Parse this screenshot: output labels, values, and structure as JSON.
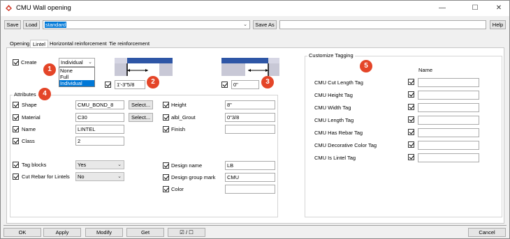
{
  "window": {
    "title": "CMU Wall opening",
    "minimize_glyph": "—",
    "maximize_glyph": "☐",
    "close_glyph": "✕"
  },
  "toolbar": {
    "save_label": "Save",
    "load_label": "Load",
    "preset_value": "standard",
    "save_as_label": "Save As",
    "save_as_value": "",
    "help_label": "Help"
  },
  "tabs": [
    {
      "label": "Opening"
    },
    {
      "label": "Lintel"
    },
    {
      "label": "Horizontal reinforcement"
    },
    {
      "label": "Tie reinforcement"
    }
  ],
  "lintel": {
    "create_label": "Create",
    "create_mode": "Individual",
    "create_options": [
      "None",
      "Full",
      "Individual"
    ],
    "left_offset": "1'-3\"5/8",
    "right_offset": "0\""
  },
  "attributes": {
    "title": "Attributes",
    "shape_label": "Shape",
    "shape_value": "CMU_BOND_8",
    "material_label": "Material",
    "material_value": "C30",
    "select_label": "Select...",
    "name_label": "Name",
    "name_value": "LINTEL",
    "class_label": "Class",
    "class_value": "2",
    "height_label": "Height",
    "height_value": "8\"",
    "grout_label": "albl_Grout",
    "grout_value": "0\"3/8",
    "finish_label": "Finish",
    "finish_value": "",
    "tag_blocks_label": "Tag blocks",
    "tag_blocks_value": "Yes",
    "cut_rebar_label": "Cut Rebar for Lintels",
    "cut_rebar_value": "No",
    "design_name_label": "Design name",
    "design_name_value": "LB",
    "design_group_label": "Design group mark",
    "design_group_value": "CMU",
    "color_label": "Color",
    "color_value": ""
  },
  "tagging": {
    "title": "Customize Tagging",
    "name_header": "Name",
    "tags": [
      {
        "label": "CMU Cut Length Tag",
        "value": ""
      },
      {
        "label": "CMU Height Tag",
        "value": ""
      },
      {
        "label": "CMU Width Tag",
        "value": ""
      },
      {
        "label": "CMU Length Tag",
        "value": ""
      },
      {
        "label": "CMU Has Rebar Tag",
        "value": ""
      },
      {
        "label": "CMU Decorative Color Tag",
        "value": ""
      },
      {
        "label": "CMU Is Lintel Tag",
        "value": ""
      }
    ]
  },
  "badges": [
    "1",
    "2",
    "3",
    "4",
    "5"
  ],
  "footer": {
    "ok_label": "OK",
    "apply_label": "Apply",
    "modify_label": "Modify",
    "get_label": "Get",
    "toggle_label": "☑ / ☐",
    "cancel_label": "Cancel"
  },
  "colors": {
    "badge": "#e44528",
    "lintel_bar": "#2e56a6",
    "selection": "#0078d7"
  }
}
